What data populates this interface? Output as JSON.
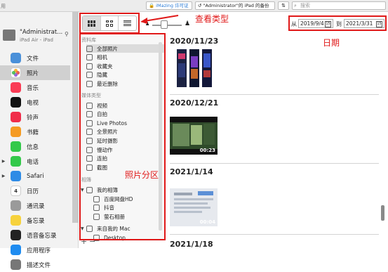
{
  "topbar": {
    "edge_label": "用",
    "imazing_label": "iMazing 许可证",
    "backup_label": "\"Administrator\"的 iPad 的备份",
    "search_placeholder": "搜索"
  },
  "device": {
    "name": "\"Administrat...",
    "model": "iPad Air - iPad"
  },
  "sidebar": {
    "items": [
      {
        "label": "文件",
        "icon": "files-icon",
        "color": "#4a90d9"
      },
      {
        "label": "照片",
        "icon": "photos-icon",
        "color": "#ffffff"
      },
      {
        "label": "音乐",
        "icon": "music-icon",
        "color": "#fa3c55"
      },
      {
        "label": "电视",
        "icon": "tv-icon",
        "color": "#111111"
      },
      {
        "label": "铃声",
        "icon": "ringtones-icon",
        "color": "#f02d4a"
      },
      {
        "label": "书籍",
        "icon": "books-icon",
        "color": "#f59b22"
      },
      {
        "label": "信息",
        "icon": "messages-icon",
        "color": "#33c94a"
      },
      {
        "label": "电话",
        "icon": "phone-icon",
        "color": "#33c94a"
      },
      {
        "label": "Safari",
        "icon": "safari-icon",
        "color": "#2e8be6"
      },
      {
        "label": "日历",
        "icon": "calendar-icon",
        "color": "#ffffff"
      },
      {
        "label": "通讯录",
        "icon": "contacts-icon",
        "color": "#9a9a9a"
      },
      {
        "label": "备忘录",
        "icon": "notes-icon",
        "color": "#f7d23c"
      },
      {
        "label": "语音备忘录",
        "icon": "voice-memos-icon",
        "color": "#222222"
      },
      {
        "label": "应用程序",
        "icon": "app-store-icon",
        "color": "#1f8cf0"
      },
      {
        "label": "描述文件",
        "icon": "profiles-icon",
        "color": "#777777"
      }
    ],
    "calendar_day": "4"
  },
  "date_filter": {
    "from_label": "从",
    "from": "2019/9/4",
    "to_label": "到",
    "to": "2021/3/31",
    "cal_icon": "15"
  },
  "annotations": {
    "view_type": "查看类型",
    "date": "日期",
    "partition": "照片分区"
  },
  "albums": {
    "section_library": "资料库",
    "library": [
      "全部照片",
      "相机",
      "收藏夹",
      "隐藏",
      "最近删除"
    ],
    "section_media": "媒体类型",
    "media": [
      "视频",
      "自拍",
      "Live Photos",
      "全景照片",
      "延时摄影",
      "慢动作",
      "连拍",
      "截图"
    ],
    "section_albums": "相簿",
    "my_albums_label": "我的相簿",
    "my_albums": [
      "百度网盘HD",
      "抖音",
      "萤石相册"
    ],
    "from_mac_label": "来自我的 Mac",
    "from_mac": [
      "Desktop"
    ],
    "footer_add": "+",
    "footer_remove": "−"
  },
  "photos": {
    "groups": [
      {
        "date": "2020/11/23",
        "duration": ""
      },
      {
        "date": "2020/12/21",
        "duration": "00:23"
      },
      {
        "date": "2021/1/14",
        "duration": "00:04"
      },
      {
        "date": "2021/1/18",
        "duration": ""
      }
    ]
  }
}
